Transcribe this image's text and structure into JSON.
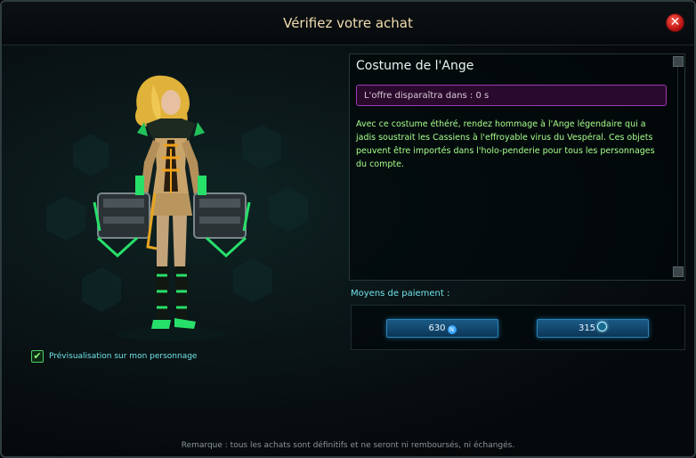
{
  "window": {
    "title": "Vérifiez votre achat",
    "close_glyph": "✕"
  },
  "preview": {
    "checked": true,
    "check_glyph": "✔",
    "label": "Prévisualisation sur mon personnage"
  },
  "item": {
    "name": "Costume de l'Ange",
    "offer_timer": "L'offre disparaîtra dans : 0 s",
    "description": "Avec ce costume éthéré, rendez hommage à l'Ange légendaire qui a jadis soustrait les Cassiens à l'effroyable virus du Vespéral. Ces objets peuvent être importés dans l'holo-penderie pour tous les personnages du compte."
  },
  "payment": {
    "label": "Moyens de paiement :",
    "options": [
      {
        "amount": "630",
        "currency_icon": "ncoin-icon"
      },
      {
        "amount": "315",
        "currency_icon": "omnibit-icon"
      }
    ]
  },
  "footer": {
    "note": "Remarque : tous les achats sont définitifs et ne seront ni remboursés, ni échangés."
  },
  "colors": {
    "title": "#f2ddb0",
    "accent_cyan": "#6fe3e8",
    "description_green": "#a7ff8c",
    "timer_border": "#9d3ab5",
    "button_blue": "#1a5a86",
    "close_red": "#b30d0d"
  }
}
